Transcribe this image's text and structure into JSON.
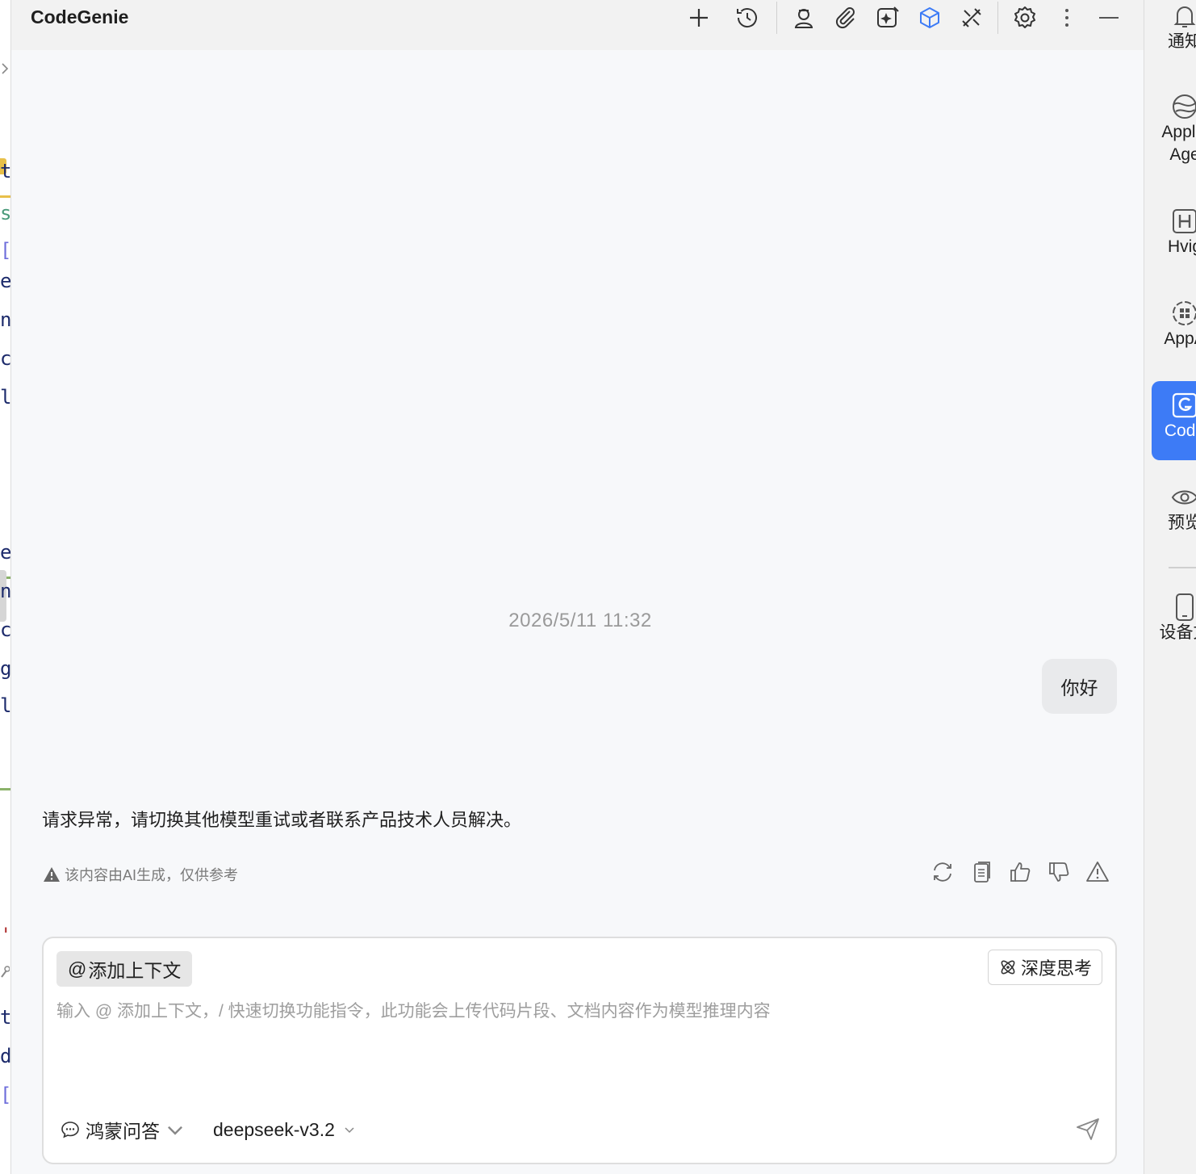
{
  "app": {
    "title": "CodeGenie"
  },
  "editor_strip": {
    "glyphs": [
      "t",
      "s",
      "[",
      "e",
      "n",
      "c",
      "l",
      "e",
      "n",
      "c",
      "g",
      "l",
      "'",
      "t",
      "d",
      "["
    ],
    "expand_icon": "chevron-right-icon"
  },
  "toolbar": {
    "icons": [
      "plus-icon",
      "history-icon",
      "user-icon",
      "attachment-icon",
      "ai-edit-icon",
      "cube-icon",
      "tools-icon",
      "gear-icon",
      "more-icon",
      "minimize-icon"
    ],
    "accent_color": "#3d7bf6"
  },
  "chat": {
    "timestamp": "2026/5/11 11:32",
    "user_message": "你好",
    "assistant_reply": "请求异常，请切换其他模型重试或者联系产品技术人员解决。",
    "disclaimer": "该内容由AI生成，仅供参考",
    "actions": [
      "refresh-icon",
      "copy-icon",
      "thumbs-up-icon",
      "thumbs-down-icon",
      "warning-icon"
    ]
  },
  "composer": {
    "add_context_at": "@",
    "add_context_label": "添加上下文",
    "deep_think_label": "深度思考",
    "placeholder": "输入 @ 添加上下文，/ 快速切换功能指令，此功能会上传代码片段、文档内容作为模型推理内容",
    "mode_label": "鸿蒙问答",
    "model_label": "deepseek-v3.2"
  },
  "rightbar": {
    "items": [
      {
        "icon": "bell-icon",
        "label": "通知"
      },
      {
        "icon": "application-agent-icon",
        "label": "Applic",
        "label2": "Age"
      },
      {
        "icon": "hvigor-icon",
        "label": "Hvig"
      },
      {
        "icon": "appanalyzer-icon",
        "label": "AppA"
      },
      {
        "icon": "codegenie-icon",
        "label": "Code",
        "active": true
      },
      {
        "icon": "eye-icon",
        "label": "预览"
      },
      {
        "icon": "device-icon",
        "label": "设备文"
      }
    ]
  }
}
